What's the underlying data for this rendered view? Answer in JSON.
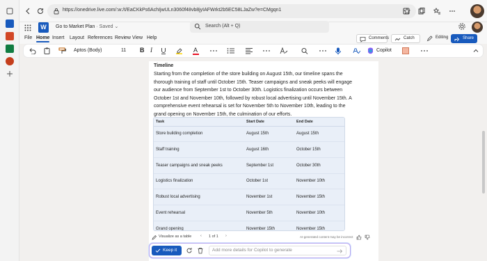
{
  "browser": {
    "url": "https://onedrive.live.com/:w:/t/EaCKkPs6AchIjwULn3060f48vb8jyIAFWrkt2b5EC58LJaZw?e=CMgqn1"
  },
  "app": {
    "doc_title": "Go to Market Plan",
    "saved_status": "· Saved",
    "search_placeholder": "Search (Alt + Q)"
  },
  "menu": {
    "tabs": [
      "File",
      "Home",
      "Insert",
      "Layout",
      "References",
      "Review",
      "View",
      "Help"
    ],
    "active_tab": "Home",
    "comments_label": "Comments",
    "catchup_label": "Catch Up",
    "editing_label": "Editing",
    "share_label": "Share"
  },
  "ribbon": {
    "font_name": "Aptos (Body)",
    "font_size": "11",
    "bold": "B",
    "italic": "I",
    "font_color_letter": "A",
    "copilot_label": "Copilot"
  },
  "document": {
    "heading": "Timeline",
    "paragraph": "Starting from the completion of the store building on August 15th, our timeline spans the thorough training of staff until October 15th. Teaser campaigns and sneak peeks will engage our audience from September 1st to October 30th. Logistics finalization occurs between October 1st and November 10th, followed by robust local advertising until November 15th. A comprehensive event rehearsal is set for November 5th to November 10th, leading to the grand opening on November 15th, the culmination of our efforts.",
    "table": {
      "headers": [
        "Task",
        "Start Date",
        "End Date"
      ],
      "rows": [
        [
          "Store building completion",
          "August 15th",
          "August 15th"
        ],
        [
          "Staff training",
          "August 16th",
          "October 15th"
        ],
        [
          "Teaser campaigns and sneak peeks",
          "September 1st",
          "October 30th"
        ],
        [
          "Logistics finalization",
          "October 1st",
          "November 10th"
        ],
        [
          "Robust local advertising",
          "November 1st",
          "November 15th"
        ],
        [
          "Event rehearsal",
          "November 5th",
          "November 10th"
        ],
        [
          "Grand opening",
          "November 15th",
          "November 15th"
        ]
      ]
    }
  },
  "copilot": {
    "visualize_label": "Visualize as a table",
    "page_indicator": "1 of 1",
    "disclaimer": "AI-generated content may be incorrect",
    "keep_label": "Keep it",
    "input_placeholder": "Add more details for Copilot to generate"
  },
  "colors": {
    "accent": "#185abd",
    "table_bg": "#e9eff8",
    "copilot_border": "#b8a6ef"
  }
}
